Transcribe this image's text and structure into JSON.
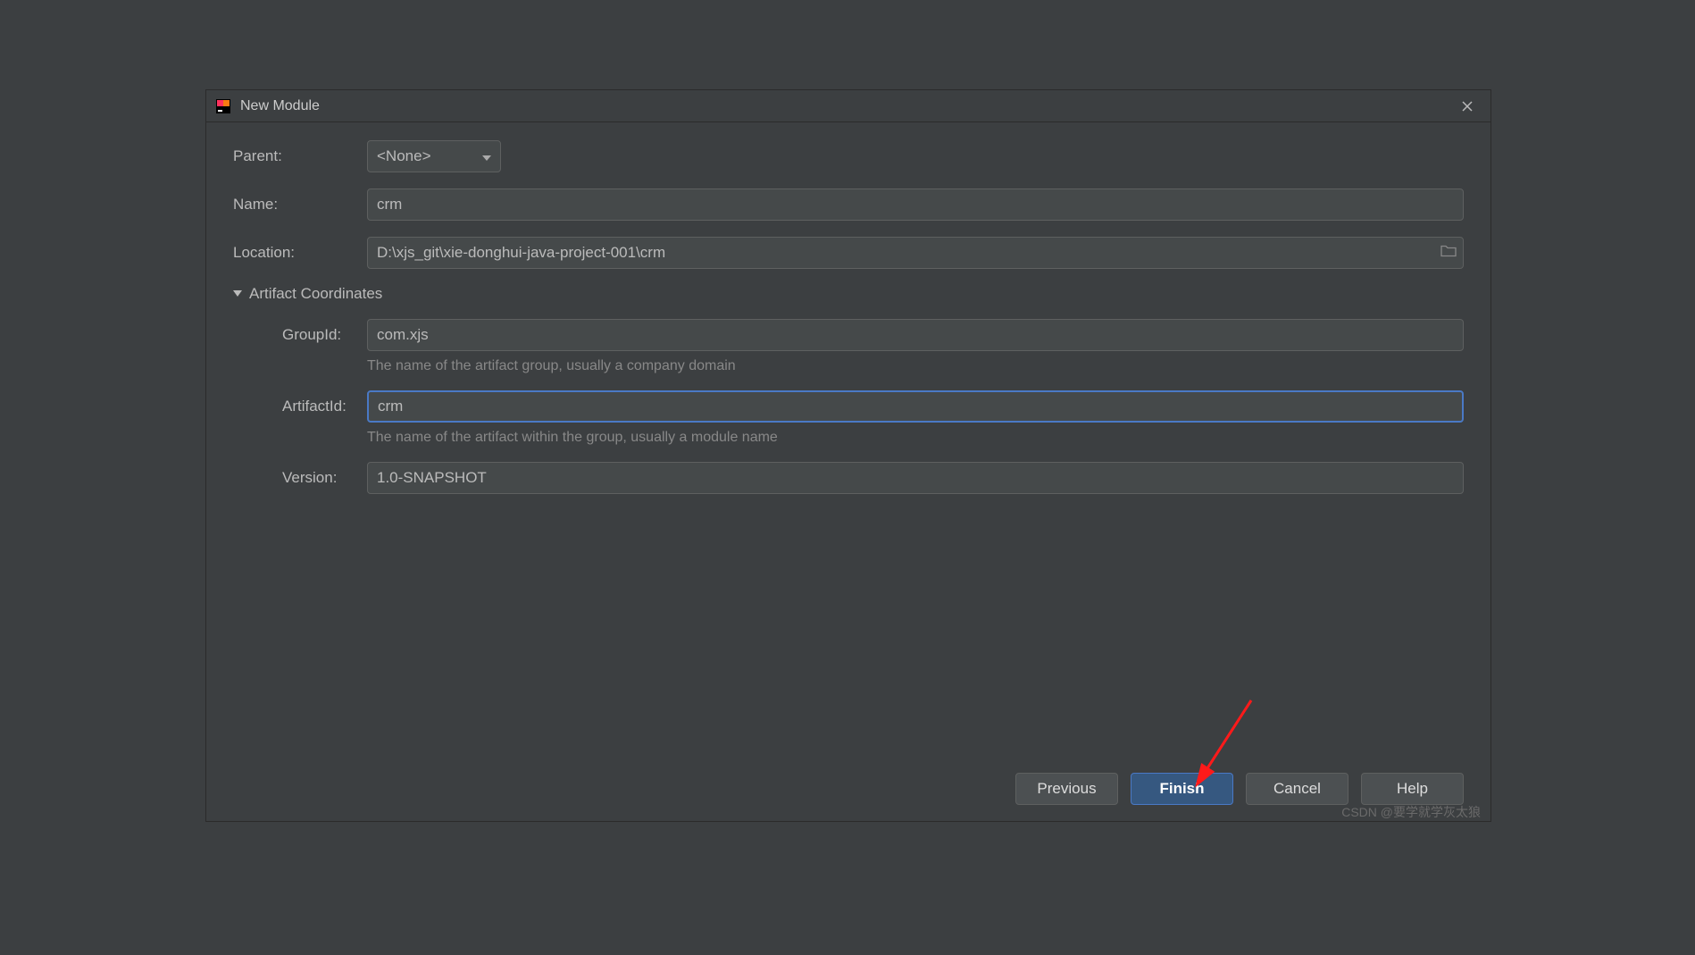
{
  "titlebar": {
    "title": "New Module"
  },
  "form": {
    "parent_label": "Parent:",
    "parent_value": "<None>",
    "name_label": "Name:",
    "name_value": "crm",
    "location_label": "Location:",
    "location_value": "D:\\xjs_git\\xie-donghui-java-project-001\\crm"
  },
  "artifact": {
    "section_title": "Artifact Coordinates",
    "groupid_label": "GroupId:",
    "groupid_value": "com.xjs",
    "groupid_help": "The name of the artifact group, usually a company domain",
    "artifactid_label": "ArtifactId:",
    "artifactid_value": "crm",
    "artifactid_help": "The name of the artifact within the group, usually a module name",
    "version_label": "Version:",
    "version_value": "1.0-SNAPSHOT"
  },
  "buttons": {
    "previous": "Previous",
    "finish": "Finish",
    "cancel": "Cancel",
    "help": "Help"
  },
  "watermark": "CSDN @要学就学灰太狼"
}
